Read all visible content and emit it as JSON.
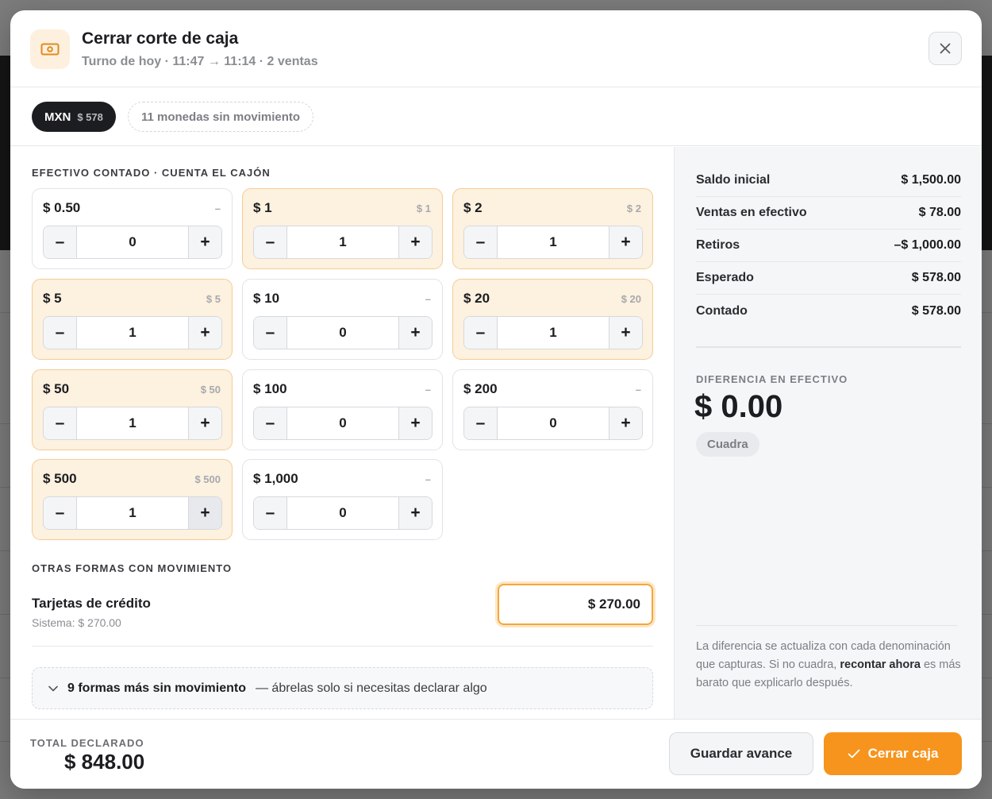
{
  "header": {
    "title": "Cerrar corte de caja",
    "subtitle": "Turno de hoy · 11:47 → 11:14 · 2 ventas"
  },
  "currency": {
    "code": "MXN",
    "amount": "$ 578",
    "inactive_label": "11 monedas sin movimiento"
  },
  "cash": {
    "section_label": "EFECTIVO CONTADO · CUENTA EL CAJÓN",
    "denominations": [
      {
        "label": "$ 0.50",
        "subtotal": "–",
        "count": "0"
      },
      {
        "label": "$ 1",
        "subtotal": "$ 1",
        "count": "1"
      },
      {
        "label": "$ 2",
        "subtotal": "$ 2",
        "count": "1"
      },
      {
        "label": "$ 5",
        "subtotal": "$ 5",
        "count": "1"
      },
      {
        "label": "$ 10",
        "subtotal": "–",
        "count": "0"
      },
      {
        "label": "$ 20",
        "subtotal": "$ 20",
        "count": "1"
      },
      {
        "label": "$ 50",
        "subtotal": "$ 50",
        "count": "1"
      },
      {
        "label": "$ 100",
        "subtotal": "–",
        "count": "0"
      },
      {
        "label": "$ 200",
        "subtotal": "–",
        "count": "0"
      },
      {
        "label": "$ 500",
        "subtotal": "$ 500",
        "count": "1"
      },
      {
        "label": "$ 1,000",
        "subtotal": "–",
        "count": "0"
      }
    ]
  },
  "other": {
    "section_label": "OTRAS FORMAS CON MOVIMIENTO",
    "card_name": "Tarjetas de crédito",
    "card_system": "Sistema: $ 270.00",
    "card_value": "$ 270.00",
    "more_strong": "9 formas más sin movimiento",
    "more_rest": "— ábrelas solo si necesitas declarar algo"
  },
  "summary": {
    "rows": [
      {
        "label": "Saldo inicial",
        "value": "$ 1,500.00"
      },
      {
        "label": "Ventas en efectivo",
        "value": "$ 78.00"
      },
      {
        "label": "Retiros",
        "value": "–$ 1,000.00"
      },
      {
        "label": "Esperado",
        "value": "$ 578.00"
      },
      {
        "label": "Contado",
        "value": "$ 578.00"
      }
    ],
    "diff_label": "DIFERENCIA EN EFECTIVO",
    "diff_value": "$ 0.00",
    "badge": "Cuadra",
    "hint_1": "La diferencia se actualiza con cada denominación que capturas. Si no cuadra, ",
    "hint_strong": "recontar ahora",
    "hint_2": " es más barato que explicarlo después."
  },
  "footer": {
    "total_label": "TOTAL DECLARADO",
    "total_value": "$ 848.00",
    "save_label": "Guardar avance",
    "close_label": "Cerrar caja"
  },
  "colors": {
    "accent": "#f7941d",
    "active_card_bg": "#fdf1df",
    "dark_pill": "#1c1d20"
  }
}
